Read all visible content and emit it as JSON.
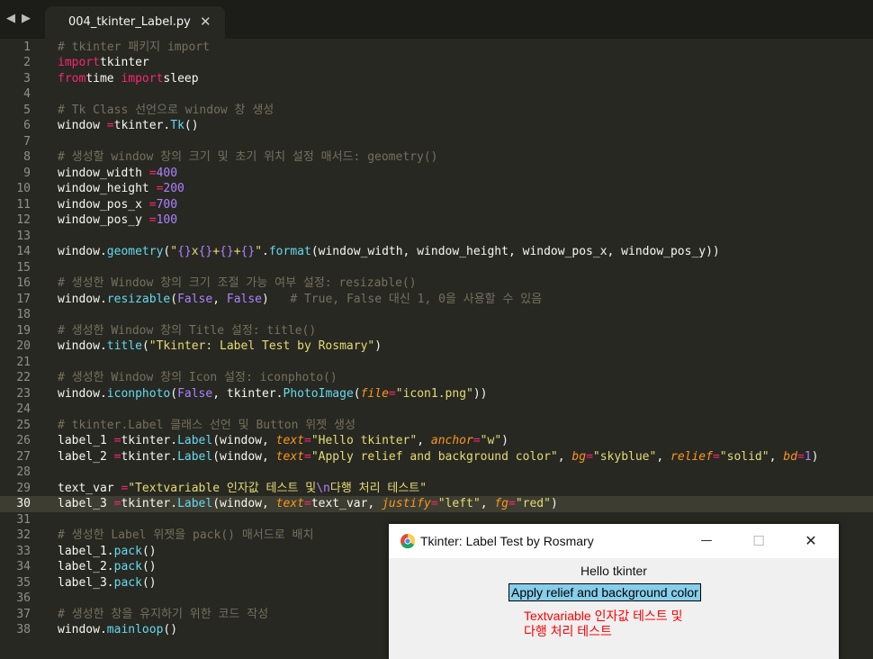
{
  "tabbar": {
    "nav_back": "◀",
    "nav_forward": "▶",
    "tab_title": "004_tkinter_Label.py",
    "tab_close": "✕"
  },
  "editor": {
    "current_line": 30,
    "lines": [
      [
        [
          "c",
          "# tkinter 패키지 import"
        ]
      ],
      [
        [
          "k",
          "import"
        ],
        [
          "",
          "tkinter"
        ]
      ],
      [
        [
          "k",
          "from"
        ],
        [
          "",
          "time "
        ],
        [
          "k",
          "import"
        ],
        [
          "",
          "sleep"
        ]
      ],
      [],
      [
        [
          "c",
          "# Tk Class 선언으로 window 창 생성"
        ]
      ],
      [
        [
          "",
          "window "
        ],
        [
          "k",
          "="
        ],
        [
          "",
          "tkinter."
        ],
        [
          "f",
          "Tk"
        ],
        [
          "",
          "()"
        ]
      ],
      [],
      [
        [
          "c",
          "# 생성할 window 창의 크기 및 초기 위치 설정 매서드: geometry()"
        ]
      ],
      [
        [
          "",
          "window_width "
        ],
        [
          "k",
          "="
        ],
        [
          "n",
          "400"
        ]
      ],
      [
        [
          "",
          "window_height "
        ],
        [
          "k",
          "="
        ],
        [
          "n",
          "200"
        ]
      ],
      [
        [
          "",
          "window_pos_x "
        ],
        [
          "k",
          "="
        ],
        [
          "n",
          "700"
        ]
      ],
      [
        [
          "",
          "window_pos_y "
        ],
        [
          "k",
          "="
        ],
        [
          "n",
          "100"
        ]
      ],
      [],
      [
        [
          "",
          "window."
        ],
        [
          "f",
          "geometry"
        ],
        [
          "",
          "("
        ],
        [
          "s",
          "\""
        ],
        [
          "n",
          "{}"
        ],
        [
          "s",
          "x"
        ],
        [
          "n",
          "{}"
        ],
        [
          "s",
          "+"
        ],
        [
          "n",
          "{}"
        ],
        [
          "s",
          "+"
        ],
        [
          "n",
          "{}"
        ],
        [
          "s",
          "\""
        ],
        [
          "",
          "."
        ],
        [
          "f",
          "format"
        ],
        [
          "",
          "(window_width, window_height, window_pos_x, window_pos_y))"
        ]
      ],
      [],
      [
        [
          "c",
          "# 생성한 Window 창의 크기 조절 가능 여부 설정: resizable()"
        ]
      ],
      [
        [
          "",
          "window."
        ],
        [
          "f",
          "resizable"
        ],
        [
          "",
          "("
        ],
        [
          "n",
          "False"
        ],
        [
          "",
          ", "
        ],
        [
          "n",
          "False"
        ],
        [
          "",
          ")   "
        ],
        [
          "c",
          "# True, False 대신 1, 0을 사용할 수 있음"
        ]
      ],
      [],
      [
        [
          "c",
          "# 생성한 Window 창의 Title 설정: title()"
        ]
      ],
      [
        [
          "",
          "window."
        ],
        [
          "f",
          "title"
        ],
        [
          "",
          "("
        ],
        [
          "s",
          "\"Tkinter: Label Test by Rosmary\""
        ],
        [
          "",
          ")"
        ]
      ],
      [],
      [
        [
          "c",
          "# 생성한 Window 창의 Icon 설정: iconphoto()"
        ]
      ],
      [
        [
          "",
          "window."
        ],
        [
          "f",
          "iconphoto"
        ],
        [
          "",
          "("
        ],
        [
          "n",
          "False"
        ],
        [
          "",
          ", tkinter."
        ],
        [
          "f",
          "PhotoImage"
        ],
        [
          "",
          "("
        ],
        [
          "p",
          "file"
        ],
        [
          "k",
          "="
        ],
        [
          "s",
          "\"icon1.png\""
        ],
        [
          "",
          "))"
        ]
      ],
      [],
      [
        [
          "c",
          "# tkinter.Label 클래스 선언 및 Button 위젯 생성"
        ]
      ],
      [
        [
          "",
          "label_1 "
        ],
        [
          "k",
          "="
        ],
        [
          "",
          "tkinter."
        ],
        [
          "f",
          "Label"
        ],
        [
          "",
          "(window, "
        ],
        [
          "p",
          "text"
        ],
        [
          "k",
          "="
        ],
        [
          "s",
          "\"Hello tkinter\""
        ],
        [
          "",
          ", "
        ],
        [
          "p",
          "anchor"
        ],
        [
          "k",
          "="
        ],
        [
          "s",
          "\"w\""
        ],
        [
          "",
          ")"
        ]
      ],
      [
        [
          "",
          "label_2 "
        ],
        [
          "k",
          "="
        ],
        [
          "",
          "tkinter."
        ],
        [
          "f",
          "Label"
        ],
        [
          "",
          "(window, "
        ],
        [
          "p",
          "text"
        ],
        [
          "k",
          "="
        ],
        [
          "s",
          "\"Apply relief and background color\""
        ],
        [
          "",
          ", "
        ],
        [
          "p",
          "bg"
        ],
        [
          "k",
          "="
        ],
        [
          "s",
          "\"skyblue\""
        ],
        [
          "",
          ", "
        ],
        [
          "p",
          "relief"
        ],
        [
          "k",
          "="
        ],
        [
          "s",
          "\"solid\""
        ],
        [
          "",
          ", "
        ],
        [
          "p",
          "bd"
        ],
        [
          "k",
          "="
        ],
        [
          "n",
          "1"
        ],
        [
          "",
          ")"
        ]
      ],
      [],
      [
        [
          "",
          "text_var "
        ],
        [
          "k",
          "="
        ],
        [
          "s",
          "\"Textvariable 인자값 테스트 및"
        ],
        [
          "n",
          "\\n"
        ],
        [
          "s",
          "다행 처리 테스트\""
        ]
      ],
      [
        [
          "",
          "label_3 "
        ],
        [
          "k",
          "="
        ],
        [
          "",
          "tkinter."
        ],
        [
          "f",
          "Label"
        ],
        [
          "",
          "(window, "
        ],
        [
          "p",
          "text"
        ],
        [
          "k",
          "="
        ],
        [
          "",
          "text_var, "
        ],
        [
          "p",
          "justify"
        ],
        [
          "k",
          "="
        ],
        [
          "s",
          "\"left\""
        ],
        [
          "",
          ", "
        ],
        [
          "p",
          "fg"
        ],
        [
          "k",
          "="
        ],
        [
          "s",
          "\"red\""
        ],
        [
          "",
          ")"
        ]
      ],
      [],
      [
        [
          "c",
          "# 생성한 Label 위젯을 pack() 매서드로 배치"
        ]
      ],
      [
        [
          "",
          "label_1."
        ],
        [
          "f",
          "pack"
        ],
        [
          "",
          "()"
        ]
      ],
      [
        [
          "",
          "label_2."
        ],
        [
          "f",
          "pack"
        ],
        [
          "",
          "()"
        ]
      ],
      [
        [
          "",
          "label_3."
        ],
        [
          "f",
          "pack"
        ],
        [
          "",
          "()"
        ]
      ],
      [],
      [
        [
          "c",
          "# 생성한 창을 유지하기 위한 코드 작성"
        ]
      ],
      [
        [
          "",
          "window."
        ],
        [
          "f",
          "mainloop"
        ],
        [
          "",
          "()"
        ]
      ]
    ]
  },
  "tkwin": {
    "title": "Tkinter: Label Test by Rosmary",
    "minimize": "—",
    "maximize": "☐",
    "close": "✕",
    "label1": "Hello tkinter",
    "label2": "Apply relief and background color",
    "label2_bg": "#87ceeb",
    "label3": "Textvariable 인자값 테스트 및\n다행 처리 테스트",
    "label3_color": "#ff0000"
  }
}
